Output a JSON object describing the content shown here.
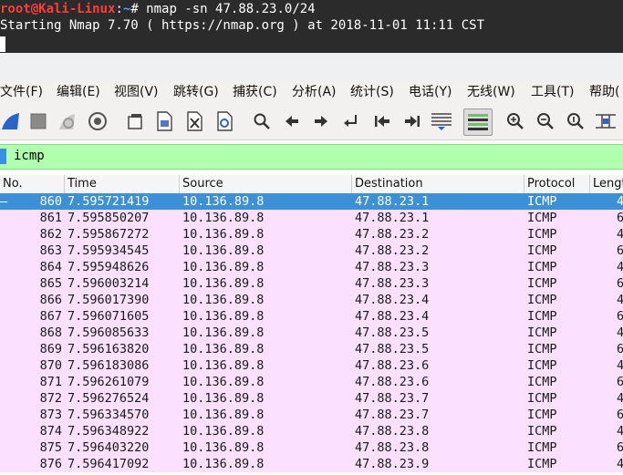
{
  "terminal": {
    "prompt_user": "root@Kali-Linux",
    "prompt_colon": ":",
    "prompt_path": "~",
    "prompt_symbol": "# ",
    "command": "nmap -sn 47.88.23.0/24",
    "output_line": "Starting Nmap 7.70 ( https://nmap.org ) at 2018-11-01 11:11 CST"
  },
  "menu": {
    "file": "文件(F)",
    "edit": "编辑(E)",
    "view": "视图(V)",
    "go": "跳转(G)",
    "capture": "捕获(C)",
    "analyze": "分析(A)",
    "statistics": "统计(S)",
    "telephony": "电话(Y)",
    "wireless": "无线(W)",
    "tools": "工具(T)",
    "help": "帮助("
  },
  "filter": {
    "value": "icmp"
  },
  "columns": {
    "no": "No.",
    "time": "Time",
    "source": "Source",
    "destination": "Destination",
    "protocol": "Protocol",
    "length": "Length"
  },
  "packets": [
    {
      "no": "860",
      "time": "7.595721419",
      "src": "10.136.89.8",
      "dst": "47.88.23.1",
      "proto": "ICMP",
      "len": "4",
      "marker": "—"
    },
    {
      "no": "861",
      "time": "7.595850207",
      "src": "10.136.89.8",
      "dst": "47.88.23.1",
      "proto": "ICMP",
      "len": "6"
    },
    {
      "no": "862",
      "time": "7.595867272",
      "src": "10.136.89.8",
      "dst": "47.88.23.2",
      "proto": "ICMP",
      "len": "4"
    },
    {
      "no": "863",
      "time": "7.595934545",
      "src": "10.136.89.8",
      "dst": "47.88.23.2",
      "proto": "ICMP",
      "len": "6"
    },
    {
      "no": "864",
      "time": "7.595948626",
      "src": "10.136.89.8",
      "dst": "47.88.23.3",
      "proto": "ICMP",
      "len": "4"
    },
    {
      "no": "865",
      "time": "7.596003214",
      "src": "10.136.89.8",
      "dst": "47.88.23.3",
      "proto": "ICMP",
      "len": "6"
    },
    {
      "no": "866",
      "time": "7.596017390",
      "src": "10.136.89.8",
      "dst": "47.88.23.4",
      "proto": "ICMP",
      "len": "4"
    },
    {
      "no": "867",
      "time": "7.596071605",
      "src": "10.136.89.8",
      "dst": "47.88.23.4",
      "proto": "ICMP",
      "len": "6"
    },
    {
      "no": "868",
      "time": "7.596085633",
      "src": "10.136.89.8",
      "dst": "47.88.23.5",
      "proto": "ICMP",
      "len": "4"
    },
    {
      "no": "869",
      "time": "7.596163820",
      "src": "10.136.89.8",
      "dst": "47.88.23.5",
      "proto": "ICMP",
      "len": "6"
    },
    {
      "no": "870",
      "time": "7.596183086",
      "src": "10.136.89.8",
      "dst": "47.88.23.6",
      "proto": "ICMP",
      "len": "4"
    },
    {
      "no": "871",
      "time": "7.596261079",
      "src": "10.136.89.8",
      "dst": "47.88.23.6",
      "proto": "ICMP",
      "len": "6"
    },
    {
      "no": "872",
      "time": "7.596276524",
      "src": "10.136.89.8",
      "dst": "47.88.23.7",
      "proto": "ICMP",
      "len": "4"
    },
    {
      "no": "873",
      "time": "7.596334570",
      "src": "10.136.89.8",
      "dst": "47.88.23.7",
      "proto": "ICMP",
      "len": "6"
    },
    {
      "no": "874",
      "time": "7.596348922",
      "src": "10.136.89.8",
      "dst": "47.88.23.8",
      "proto": "ICMP",
      "len": "4"
    },
    {
      "no": "875",
      "time": "7.596403220",
      "src": "10.136.89.8",
      "dst": "47.88.23.8",
      "proto": "ICMP",
      "len": "6"
    },
    {
      "no": "876",
      "time": "7.596417092",
      "src": "10.136.89.8",
      "dst": "47.88.23.9",
      "proto": "ICMP",
      "len": "4"
    }
  ],
  "colors": {
    "row_icmp": "#fce0ff",
    "row_selected": "#3d8fd6",
    "filter_valid": "#afffaf"
  },
  "toolbar_icons": [
    "shark-fin-start-icon",
    "stop-icon",
    "restart-icon",
    "options-gear-icon",
    "open-file-icon",
    "save-file-icon",
    "close-file-icon",
    "reload-icon",
    "find-icon",
    "back-arrow-icon",
    "forward-arrow-icon",
    "goto-packet-icon",
    "first-packet-icon",
    "last-packet-icon",
    "autoscroll-icon",
    "colorize-icon",
    "zoom-in-icon",
    "zoom-out-icon",
    "normal-size-icon",
    "resize-columns-icon"
  ]
}
